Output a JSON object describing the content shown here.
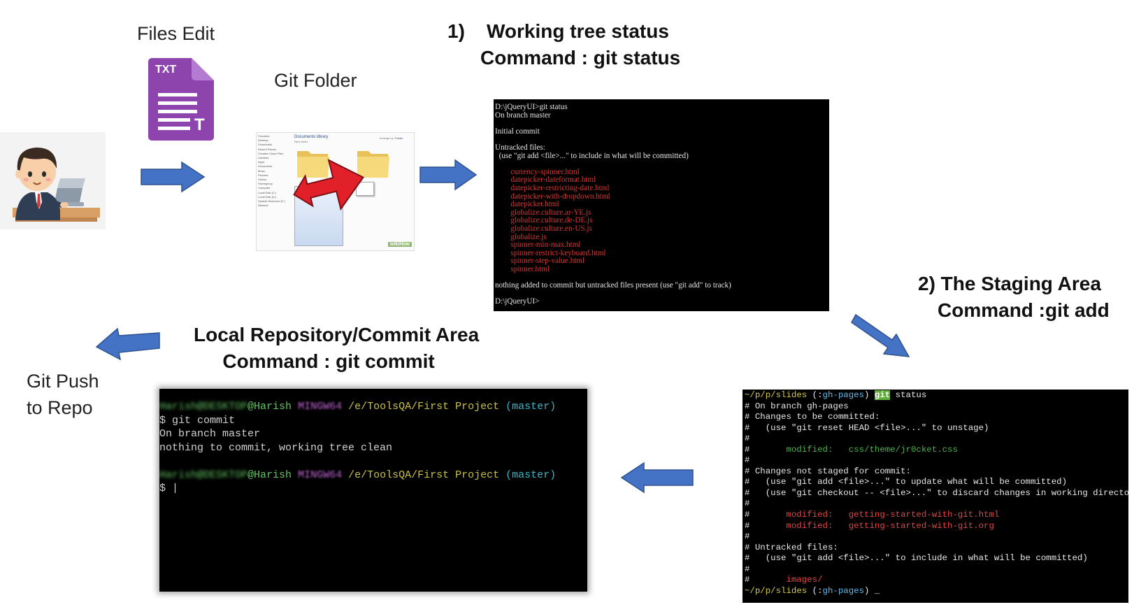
{
  "labels": {
    "files_edit": "Files Edit",
    "git_folder": "Git Folder",
    "git_push_line1": "Git Push",
    "git_push_line2": "to Repo"
  },
  "headings": {
    "working_tree_line1": "1)    Working tree status",
    "working_tree_line2": "Command : git status",
    "staging_line1": "2) The Staging Area",
    "staging_line2": "Command :git add",
    "local_repo_line1": "Local Repository/Commit Area",
    "local_repo_line2": "Command : git commit"
  },
  "txt_icon": {
    "badge": "TXT",
    "letter": "T",
    "color": "#8e44ad"
  },
  "explorer": {
    "header": "Documents library",
    "subheader": "New folder",
    "arrange": "Arrange by:",
    "arrange_value": "Folder",
    "watermark": "wikiHow",
    "sidebar": [
      "Favorites",
      "Desktop",
      "Downloads",
      "Recent Places",
      "Creative Cloud Files",
      "Libraries",
      "Apps",
      "Documents",
      "Music",
      "Pictures",
      "Videos",
      "Homegroup",
      "Computer",
      "Local Disk (C:)",
      "Local Disk (D:)",
      "System Reserved (F:)",
      "Network"
    ]
  },
  "terminal_status": {
    "lines": [
      {
        "t": "D:\\jQueryUI>git status",
        "c": ""
      },
      {
        "t": "On branch master",
        "c": ""
      },
      {
        "t": "",
        "c": ""
      },
      {
        "t": "Initial commit",
        "c": ""
      },
      {
        "t": "",
        "c": ""
      },
      {
        "t": "Untracked files:",
        "c": ""
      },
      {
        "t": "  (use \"git add <file>...\" to include in what will be committed)",
        "c": ""
      },
      {
        "t": "",
        "c": ""
      },
      {
        "t": "        currency-spinner.html",
        "c": "red"
      },
      {
        "t": "        datepicker-dateformat.html",
        "c": "red"
      },
      {
        "t": "        datepicker-restricting-date.html",
        "c": "red"
      },
      {
        "t": "        datepicker-with-dropdown.html",
        "c": "red"
      },
      {
        "t": "        datepicker.html",
        "c": "red"
      },
      {
        "t": "        globalize.culture.ar-YE.js",
        "c": "red"
      },
      {
        "t": "        globalize.culture.de-DE.js",
        "c": "red"
      },
      {
        "t": "        globalize.culture.en-US.js",
        "c": "red"
      },
      {
        "t": "        globalize.js",
        "c": "red"
      },
      {
        "t": "        spinner-min-max.html",
        "c": "red"
      },
      {
        "t": "        spinner-restrict-keyboard.html",
        "c": "red"
      },
      {
        "t": "        spinner-step-value.html",
        "c": "red"
      },
      {
        "t": "        spinner.html",
        "c": "red"
      },
      {
        "t": "",
        "c": ""
      },
      {
        "t": "nothing added to commit but untracked files present (use \"git add\" to track)",
        "c": ""
      },
      {
        "t": "",
        "c": ""
      },
      {
        "t": "D:\\jQueryUI>",
        "c": ""
      }
    ]
  },
  "terminal_commit": {
    "user": "@Harish",
    "host": "MINGW64",
    "path": "/e/ToolsQA/First Project",
    "branch": "(master)",
    "hidden_prefix": "Harish@DESKTOP",
    "cmd": "$ git commit",
    "out1": "On branch master",
    "out2": "nothing to commit, working tree clean",
    "prompt_end": "$ |"
  },
  "terminal_add": {
    "path": "~/p/p/slides",
    "branch_open": " (:",
    "branch": "gh-pages",
    "branch_close": ")",
    "git": "git",
    "cmd_rest": " status",
    "lines": [
      "# On branch gh-pages",
      "# Changes to be committed:",
      "#   (use \"git reset HEAD <file>...\" to unstage)",
      "#",
      "#       modified:   css/theme/jr0cket.css",
      "#",
      "# Changes not staged for commit:",
      "#   (use \"git add <file>...\" to update what will be committed)",
      "#   (use \"git checkout -- <file>...\" to discard changes in working directory)",
      "#",
      "#       modified:   getting-started-with-git.html",
      "#       modified:   getting-started-with-git.org",
      "#",
      "# Untracked files:",
      "#   (use \"git add <file>...\" to include in what will be committed)",
      "#",
      "#       images/"
    ],
    "end_cursor": " _"
  },
  "colors": {
    "arrow": "#4472c4",
    "arrow_stroke": "#2f528f"
  }
}
